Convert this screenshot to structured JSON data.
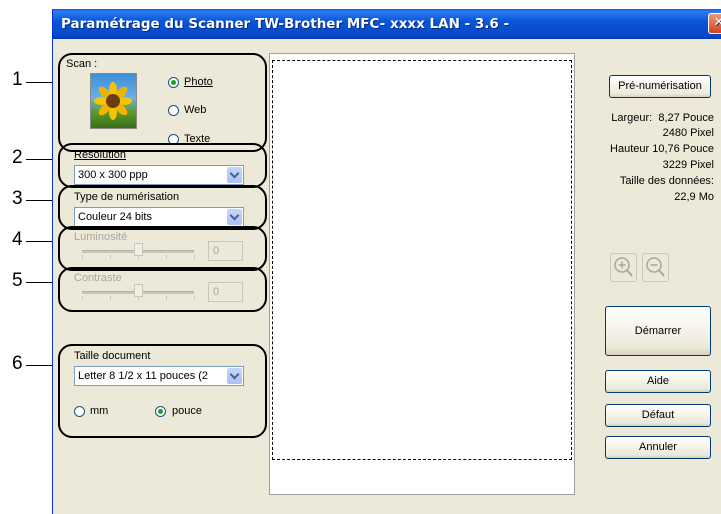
{
  "window": {
    "title": "Paramétrage du Scanner TW-Brother MFC- xxxx   LAN - 3.6 -",
    "close_label": "✕"
  },
  "callouts": [
    "1",
    "2",
    "3",
    "4",
    "5",
    "6"
  ],
  "scan": {
    "label": "Scan :",
    "options": {
      "photo": "Photo",
      "web": "Web",
      "texte": "Texte"
    },
    "selected": "Photo"
  },
  "resolution": {
    "label": "Résolution",
    "value": "300 x 300 ppp"
  },
  "scan_type": {
    "label": "Type de numérisation",
    "value": "Couleur 24 bits"
  },
  "brightness": {
    "label": "Luminosité",
    "value": "0"
  },
  "contrast": {
    "label": "Contraste",
    "value": "0"
  },
  "document_size": {
    "label": "Taille document",
    "value": "Letter 8 1/2 x 11 pouces (2",
    "units": {
      "mm": "mm",
      "inch": "pouce"
    },
    "selected_unit": "pouce"
  },
  "buttons": {
    "prescan": "Pré-numérisation",
    "start": "Démarrer",
    "help": "Aide",
    "default": "Défaut",
    "cancel": "Annuler"
  },
  "info": {
    "width_label": "Largeur:",
    "width_value": "8,27 Pouce",
    "width_pixels": "2480 Pixel",
    "height_label": "Hauteur",
    "height_value": "10,76 Pouce",
    "height_pixels": "3229 Pixel",
    "data_size_label": "Taille des données:",
    "data_size_value": "22,9 Mo"
  },
  "icons": {
    "zoom_in": "zoom-in-icon",
    "zoom_out": "zoom-out-icon",
    "thumbnail": "sunflower-photo-icon"
  }
}
